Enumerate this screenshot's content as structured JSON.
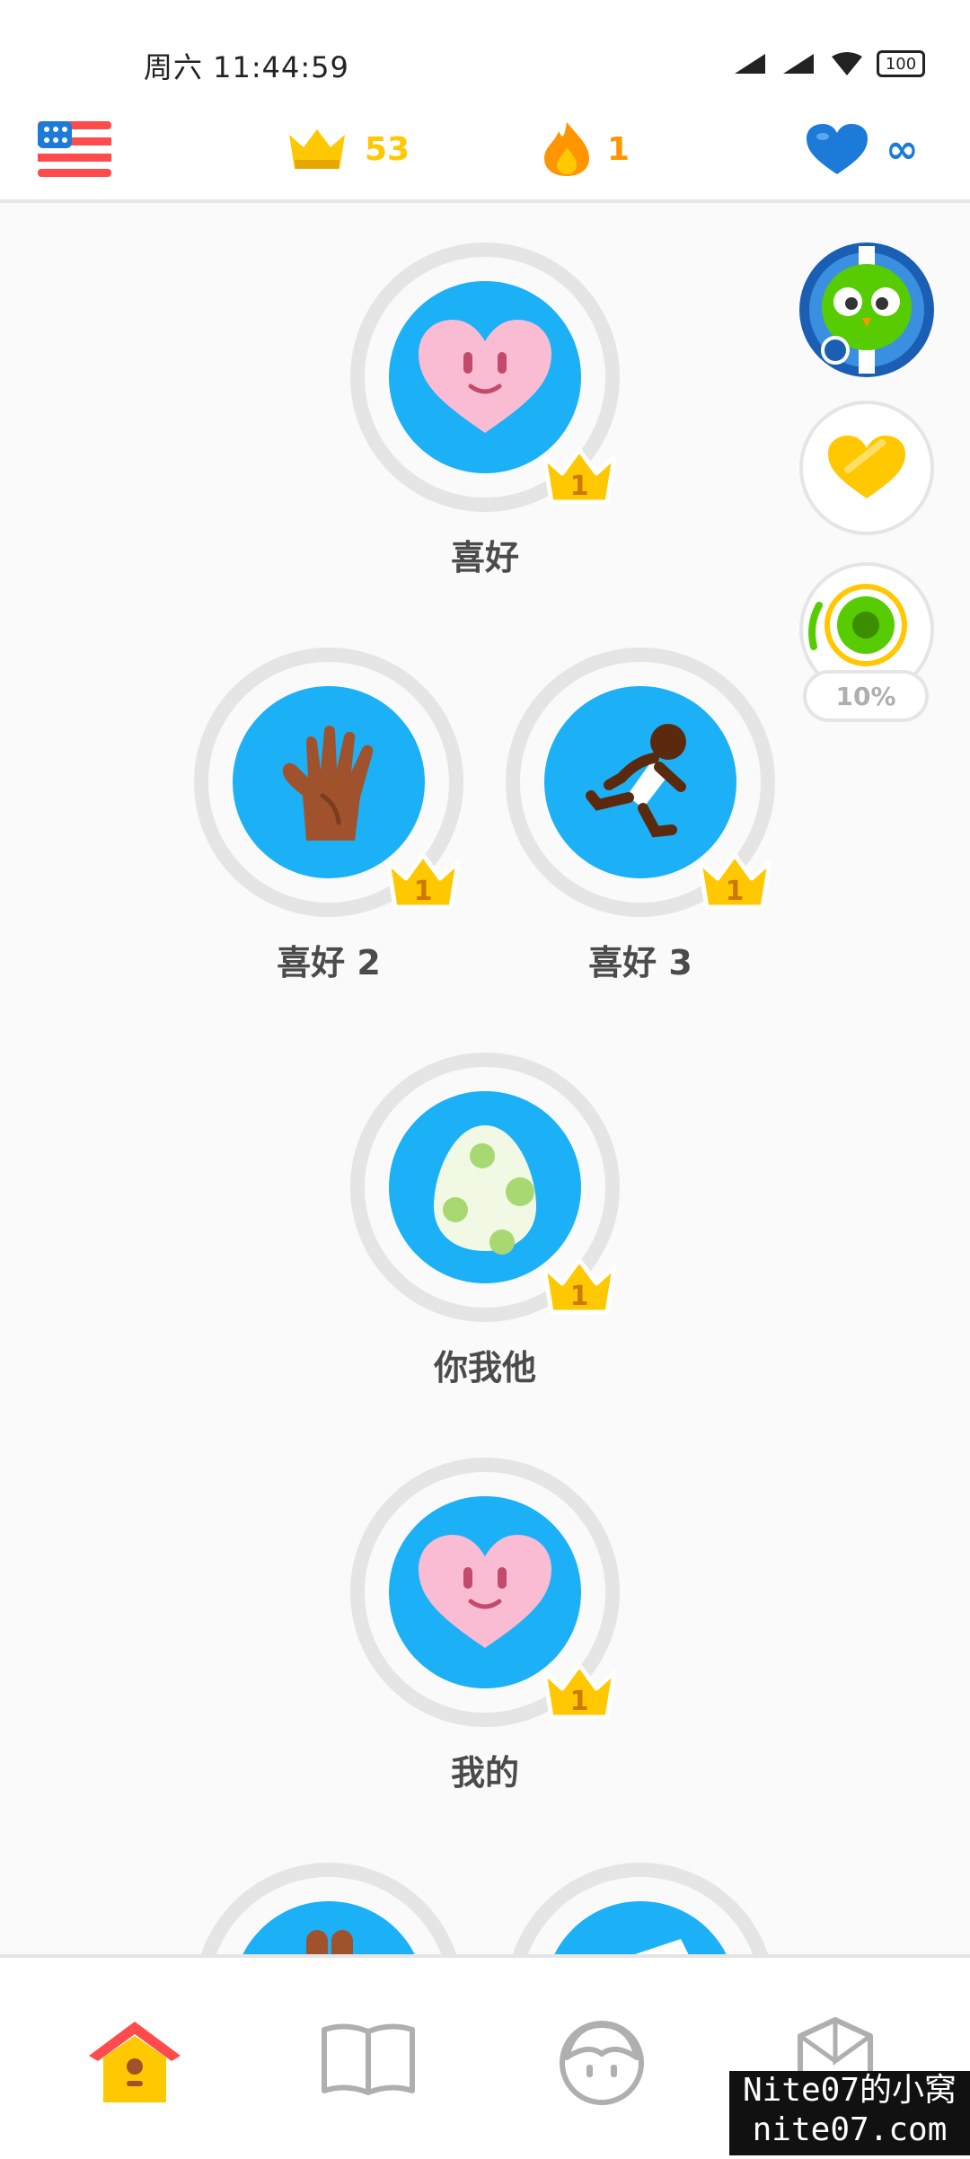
{
  "status_bar": {
    "time": "周六 11:44:59",
    "battery": "100"
  },
  "top_bar": {
    "crowns": "53",
    "streak": "1",
    "hearts": "∞",
    "icons": [
      "us-flag-icon",
      "crown-icon",
      "flame-icon",
      "heart-icon"
    ]
  },
  "skills": [
    {
      "label": "喜好",
      "crown_level": "1",
      "icon": "smiling-heart-icon"
    },
    {
      "label": "喜好 2",
      "crown_level": "1",
      "icon": "waving-hand-icon"
    },
    {
      "label": "喜好 3",
      "crown_level": "1",
      "icon": "running-person-icon"
    },
    {
      "label": "你我他",
      "crown_level": "1",
      "icon": "spotted-egg-icon"
    },
    {
      "label": "我的",
      "crown_level": "1",
      "icon": "smiling-heart-icon"
    }
  ],
  "side_panel": {
    "progress_label": "10%",
    "progress_value": 0.1,
    "icons": [
      "owl-character-icon",
      "gold-heart-icon",
      "xp-chest-icon"
    ]
  },
  "bottom_nav": {
    "icons": [
      "home-icon",
      "book-icon",
      "profile-face-icon",
      "shield-icon"
    ],
    "active": "home-icon"
  },
  "watermark": {
    "line1": "Nite07的小窝",
    "line2": "nite07.com"
  },
  "colors": {
    "accent_blue": "#1cb0f6",
    "crown_gold": "#ffc800",
    "streak_orange": "#ff9600",
    "heart_blue": "#1c7ad8"
  }
}
